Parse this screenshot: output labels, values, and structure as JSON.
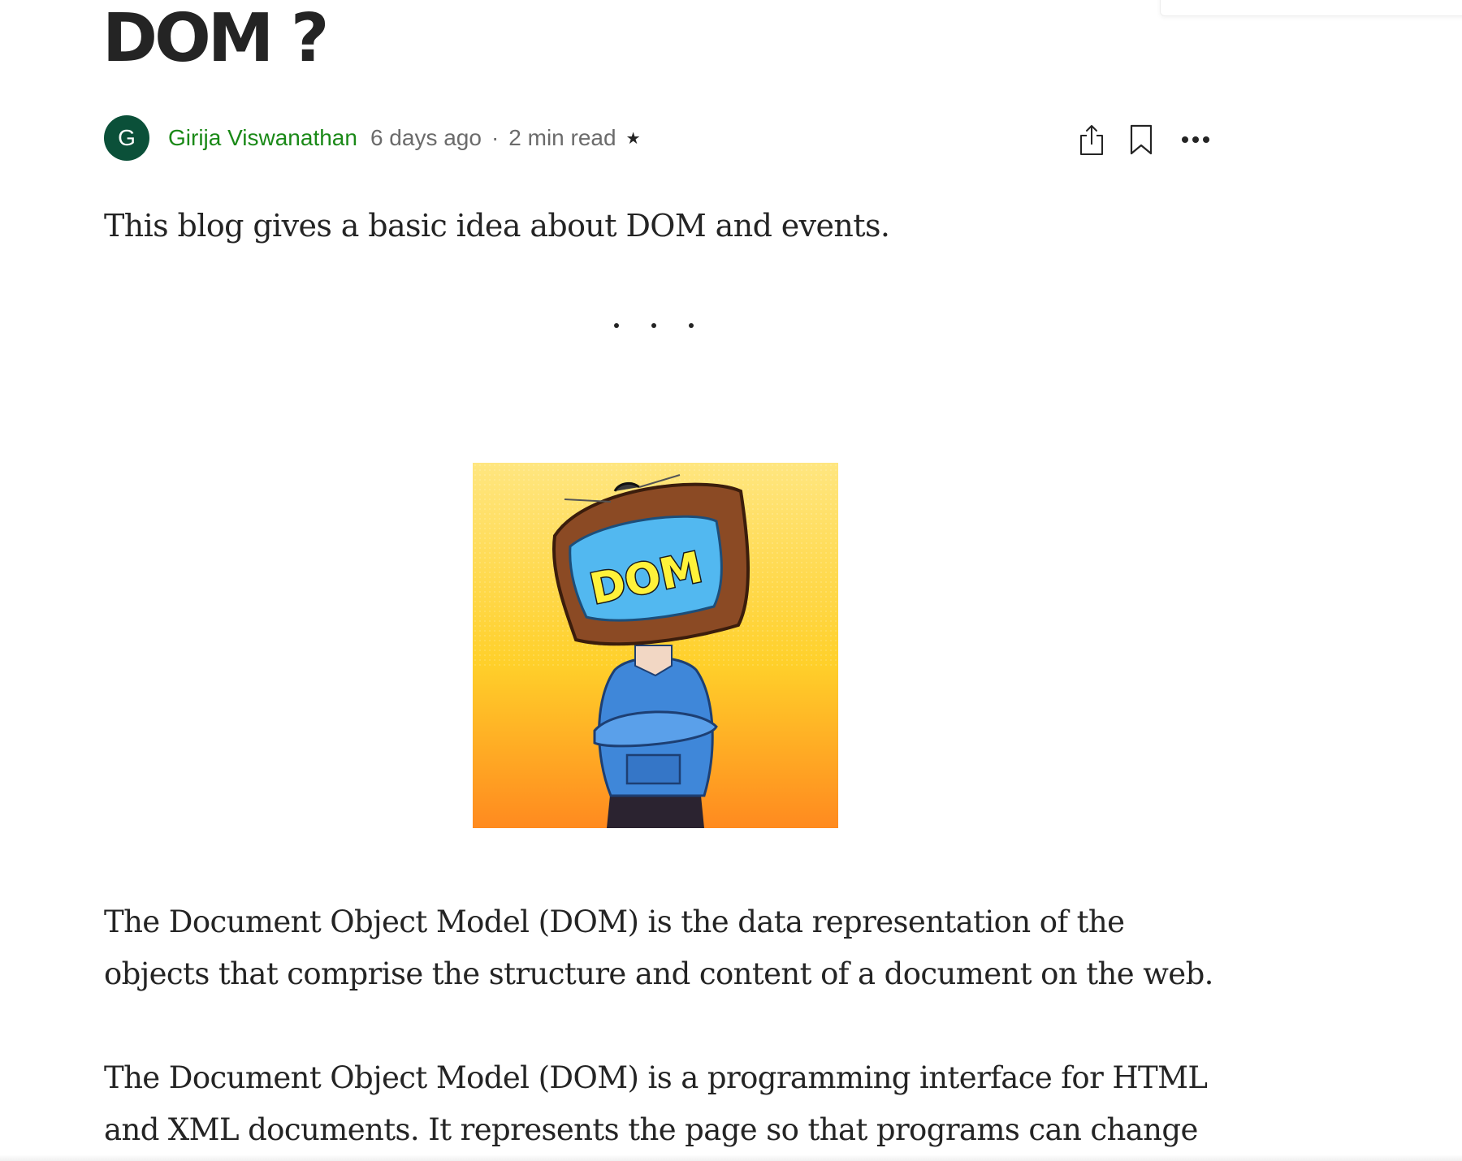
{
  "article": {
    "title": "DOM ?",
    "subtitle": "This blog gives a basic idea about DOM and events.",
    "author": {
      "initial": "G",
      "name": "Girija Viswanathan"
    },
    "published": "6 days ago",
    "read_time": "2 min read",
    "member_only_icon": "star-icon",
    "separator_icon": "three-dots-separator",
    "image": {
      "text": "DOM",
      "colors": {
        "background_top": "#FFE680",
        "background_bottom": "#FF8A1F",
        "screen": "#52B8F0",
        "tv_frame": "#8B4A24",
        "hoodie": "#3F87D9",
        "word": "#FFF23A"
      }
    },
    "paragraphs": [
      {
        "lines": [
          "The Document Object Model (DOM) is the data representation of the",
          "objects that comprise the structure and content of a document on the web."
        ]
      },
      {
        "lines": [
          "The Document Object Model (DOM) is a programming interface for HTML",
          "and XML documents. It represents the page so that programs can change"
        ]
      }
    ]
  },
  "actions": {
    "share_icon": "share-icon",
    "bookmark_icon": "bookmark-icon",
    "more_icon": "more-icon"
  },
  "colors": {
    "author_link": "#1A8917",
    "avatar": "#0B5039",
    "text": "#242424",
    "muted": "#6B6B6B"
  }
}
